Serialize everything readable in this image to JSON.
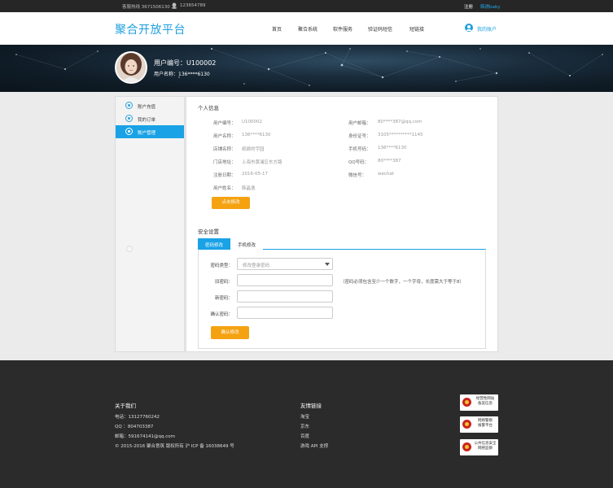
{
  "topbar": {
    "hotline": "客服热线 3671506130",
    "qq": "123654789",
    "login": "注册",
    "username": "韩孺baby"
  },
  "header": {
    "logo": "聚合开放平台",
    "nav": [
      "首页",
      "聚合系统",
      "软件服务",
      "验证码短信",
      "短链接"
    ],
    "account": "我的账户"
  },
  "profile": {
    "uid_line": "用户编号：U100002",
    "uname_line": "用户名称：136****6130"
  },
  "sidebar": {
    "items": [
      {
        "label": "账户充值",
        "icon": "wallet-icon",
        "active": false
      },
      {
        "label": "我的订单",
        "icon": "order-icon",
        "active": false
      },
      {
        "label": "账户管理",
        "icon": "account-manage-icon",
        "active": true
      }
    ]
  },
  "info": {
    "title": "个人信息",
    "left": [
      {
        "label": "用户编号：",
        "value": "U100002"
      },
      {
        "label": "用户名称：",
        "value": "136****6130"
      },
      {
        "label": "店铺名称：",
        "value": "纸嫁的宇园"
      },
      {
        "label": "门店地址：",
        "value": "上海市黄浦区东方路"
      },
      {
        "label": "注册日期：",
        "value": "2016-05-17"
      },
      {
        "label": "用户姓名：",
        "value": "韩晶逸"
      }
    ],
    "right": [
      {
        "label": "用户邮箱：",
        "value": "80****387@qq.com"
      },
      {
        "label": "身份证号：",
        "value": "3105**********1145"
      },
      {
        "label": "手机号码：",
        "value": "136****6130"
      },
      {
        "label": "QQ号码：",
        "value": "80****387"
      },
      {
        "label": "微信号：",
        "value": "wechat"
      }
    ],
    "edit_button": "点击修改"
  },
  "security": {
    "title": "安全设置",
    "tabs": [
      "密码修改",
      "手机修改"
    ],
    "type_label": "密码类型：",
    "type_value": "修改登录密码",
    "old_label": "旧密码：",
    "new_label": "新密码：",
    "confirm_label": "确认密码：",
    "hint": "（密码必须包含至少一个数字，一个字母，长度需大于等于8）",
    "submit": "确认修改"
  },
  "footer": {
    "about_title": "关于我们",
    "phone": "电话：13127760242",
    "qq": "QQ ：804703387",
    "email": "邮箱：591674141@qq.com",
    "copyright": "© 2015-2016 聚合意筑 版权所有 沪 ICP 备 16038649 号",
    "links_title": "友情链接",
    "links": [
      "淘宝",
      "京东",
      "百度",
      "游戏 API 支撑"
    ],
    "badges": [
      {
        "line1": "经营性网站",
        "line2": "备案信息"
      },
      {
        "line1": "网络警察",
        "line2": "报警平台"
      },
      {
        "line1": "公共信息安全",
        "line2": "网络监察"
      }
    ]
  }
}
